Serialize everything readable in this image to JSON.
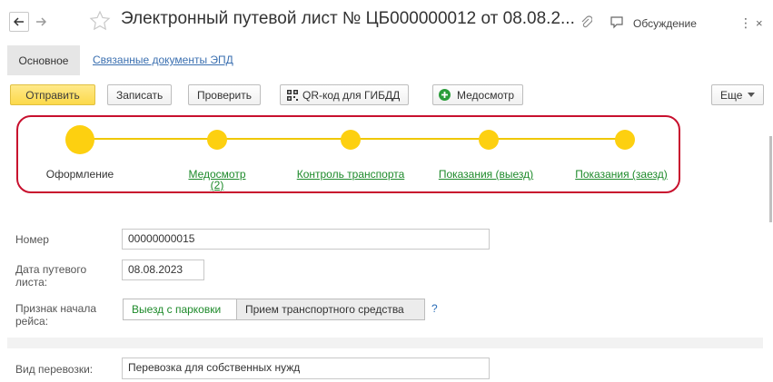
{
  "window": {
    "title": "Электронный путевой лист № ЦБ000000012 от 08.08.2...",
    "discussion_label": "Обсуждение"
  },
  "tabs": {
    "main": "Основное",
    "related": "Связанные документы ЭПД"
  },
  "toolbar": {
    "send": "Отправить",
    "save": "Записать",
    "check": "Проверить",
    "qr": "QR-код для ГИБДД",
    "medical": "Медосмотр",
    "more": "Еще"
  },
  "stages": [
    {
      "label": "Оформление",
      "sub": "",
      "state": "current"
    },
    {
      "label": "Медосмотр",
      "sub": "(2)",
      "state": "link"
    },
    {
      "label": "Контроль транспорта",
      "sub": "",
      "state": "link"
    },
    {
      "label": "Показания (выезд)",
      "sub": "",
      "state": "link"
    },
    {
      "label": "Показания (заезд)",
      "sub": "",
      "state": "link"
    }
  ],
  "form": {
    "number_label": "Номер",
    "number_value": "00000000015",
    "date_label_1": "Дата путевого",
    "date_label_2": "листа:",
    "date_value": "08.08.2023",
    "trip_start_label_1": "Признак начала",
    "trip_start_label_2": "рейса:",
    "trip_start_option_1": "Выезд с парковки",
    "trip_start_option_2": "Прием транспортного средства",
    "help": "?",
    "transport_type_label": "Вид перевозки:",
    "transport_type_value": "Перевозка для собственных нужд"
  },
  "colors": {
    "accent_yellow": "#fdd010",
    "link_green": "#1d8a2a",
    "highlight_red": "#c8102e",
    "link_blue": "#3a6fb0"
  }
}
